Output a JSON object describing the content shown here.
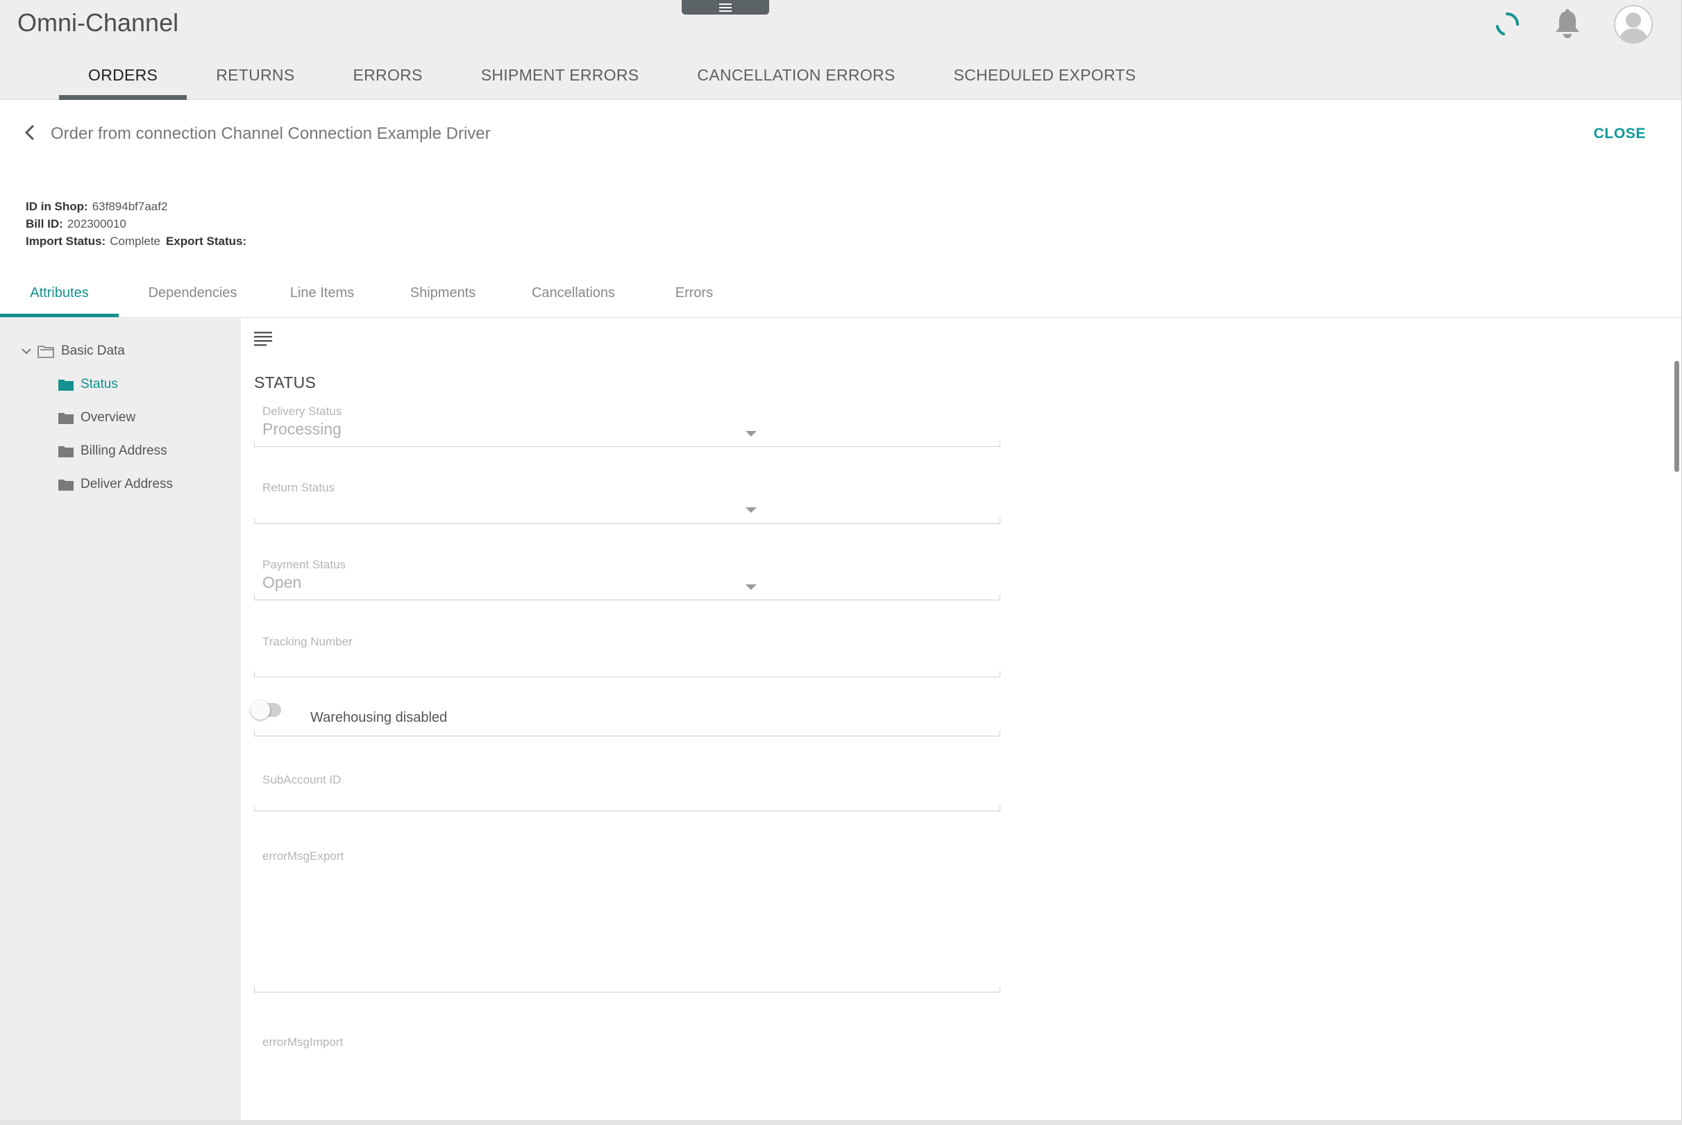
{
  "app": {
    "title": "Omni-Channel"
  },
  "header": {
    "icons": [
      "menu-icon",
      "loading-spinner-icon",
      "bell-icon",
      "user-avatar-icon"
    ],
    "accent_color": "#13928f"
  },
  "main_tabs": [
    {
      "label": "ORDERS",
      "active": true
    },
    {
      "label": "RETURNS",
      "active": false
    },
    {
      "label": "ERRORS",
      "active": false
    },
    {
      "label": "SHIPMENT ERRORS",
      "active": false
    },
    {
      "label": "CANCELLATION ERRORS",
      "active": false
    },
    {
      "label": "SCHEDULED EXPORTS",
      "active": false
    }
  ],
  "detail": {
    "title": "Order from connection Channel Connection Example Driver",
    "close_label": "CLOSE",
    "meta": {
      "id_in_shop_label": "ID in Shop:",
      "id_in_shop_value": "63f894bf7aaf2",
      "bill_id_label": "Bill ID:",
      "bill_id_value": "202300010",
      "import_status_label": "Import Status:",
      "import_status_value": "Complete",
      "export_status_label": "Export Status:",
      "export_status_value": ""
    }
  },
  "sub_tabs": [
    {
      "label": "Attributes",
      "active": true
    },
    {
      "label": "Dependencies",
      "active": false
    },
    {
      "label": "Line Items",
      "active": false
    },
    {
      "label": "Shipments",
      "active": false
    },
    {
      "label": "Cancellations",
      "active": false
    },
    {
      "label": "Errors",
      "active": false
    }
  ],
  "tree": {
    "root": "Basic Data",
    "items": [
      {
        "label": "Status",
        "selected": true
      },
      {
        "label": "Overview",
        "selected": false
      },
      {
        "label": "Billing Address",
        "selected": false
      },
      {
        "label": "Deliver Address",
        "selected": false
      }
    ]
  },
  "form": {
    "section_title": "STATUS",
    "delivery_status": {
      "label": "Delivery Status",
      "value": "Processing"
    },
    "return_status": {
      "label": "Return Status",
      "value": ""
    },
    "payment_status": {
      "label": "Payment Status",
      "value": "Open"
    },
    "tracking_number": {
      "label": "Tracking Number",
      "value": ""
    },
    "warehousing": {
      "label": "Warehousing disabled",
      "enabled": false
    },
    "subaccount_id": {
      "label": "SubAccount ID",
      "value": ""
    },
    "error_msg_export": {
      "label": "errorMsgExport",
      "value": ""
    },
    "error_msg_import": {
      "label": "errorMsgImport",
      "value": ""
    }
  }
}
